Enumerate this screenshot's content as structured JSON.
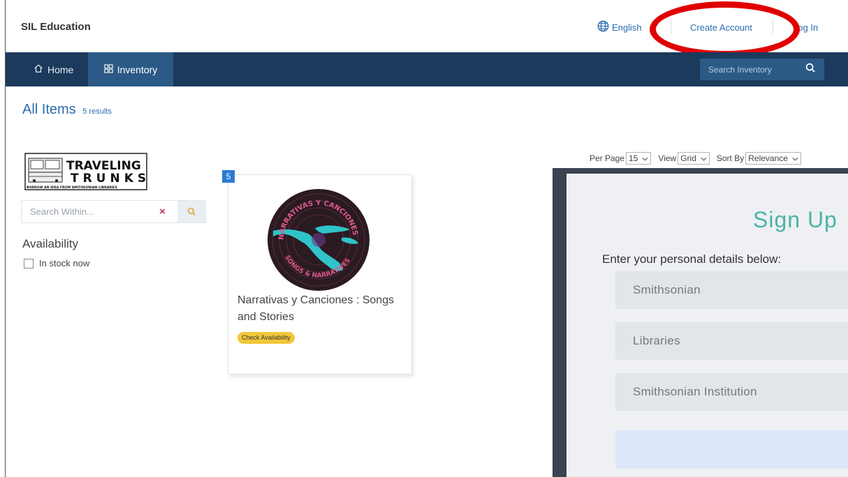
{
  "header": {
    "brand": "SIL Education",
    "language": "English",
    "create_account": "Create Account",
    "login": "Log In"
  },
  "nav": {
    "home": "Home",
    "inventory": "Inventory",
    "search_placeholder": "Search Inventory"
  },
  "page": {
    "title": "All Items",
    "results": "5 results"
  },
  "sidebar": {
    "search_placeholder": "Search Within...",
    "availability_title": "Availability",
    "in_stock_label": "In stock now",
    "logo_line1": "TRAVELING",
    "logo_line2": "TRUNKS",
    "logo_tagline": "BORROW AN IDEA FROM SMITHSONIAN LIBRARIES"
  },
  "controls": {
    "per_page_label": "Per Page",
    "per_page_value": "15",
    "view_label": "View",
    "view_value": "Grid",
    "sort_label": "Sort By",
    "sort_value": "Relevance"
  },
  "item": {
    "count_badge": "5",
    "title": "Narrativas y Canciones : Songs and Stories",
    "availability_button": "Check Availability",
    "art_text_top": "NARRATIVAS Y CANCIONES",
    "art_text_bottom": "SONGS & NARRATIVES"
  },
  "signup": {
    "title": "Sign Up",
    "description": "Enter your personal details below:",
    "fields": [
      "Smithsonian",
      "Libraries",
      "Smithsonian Institution"
    ]
  },
  "colors": {
    "nav_bg": "#1b3a5c",
    "nav_active": "#2c5a86",
    "link": "#2b6cb0",
    "highlight_circle": "#e00000",
    "badge": "#f3c73a",
    "signup_title": "#4bb3a4"
  }
}
